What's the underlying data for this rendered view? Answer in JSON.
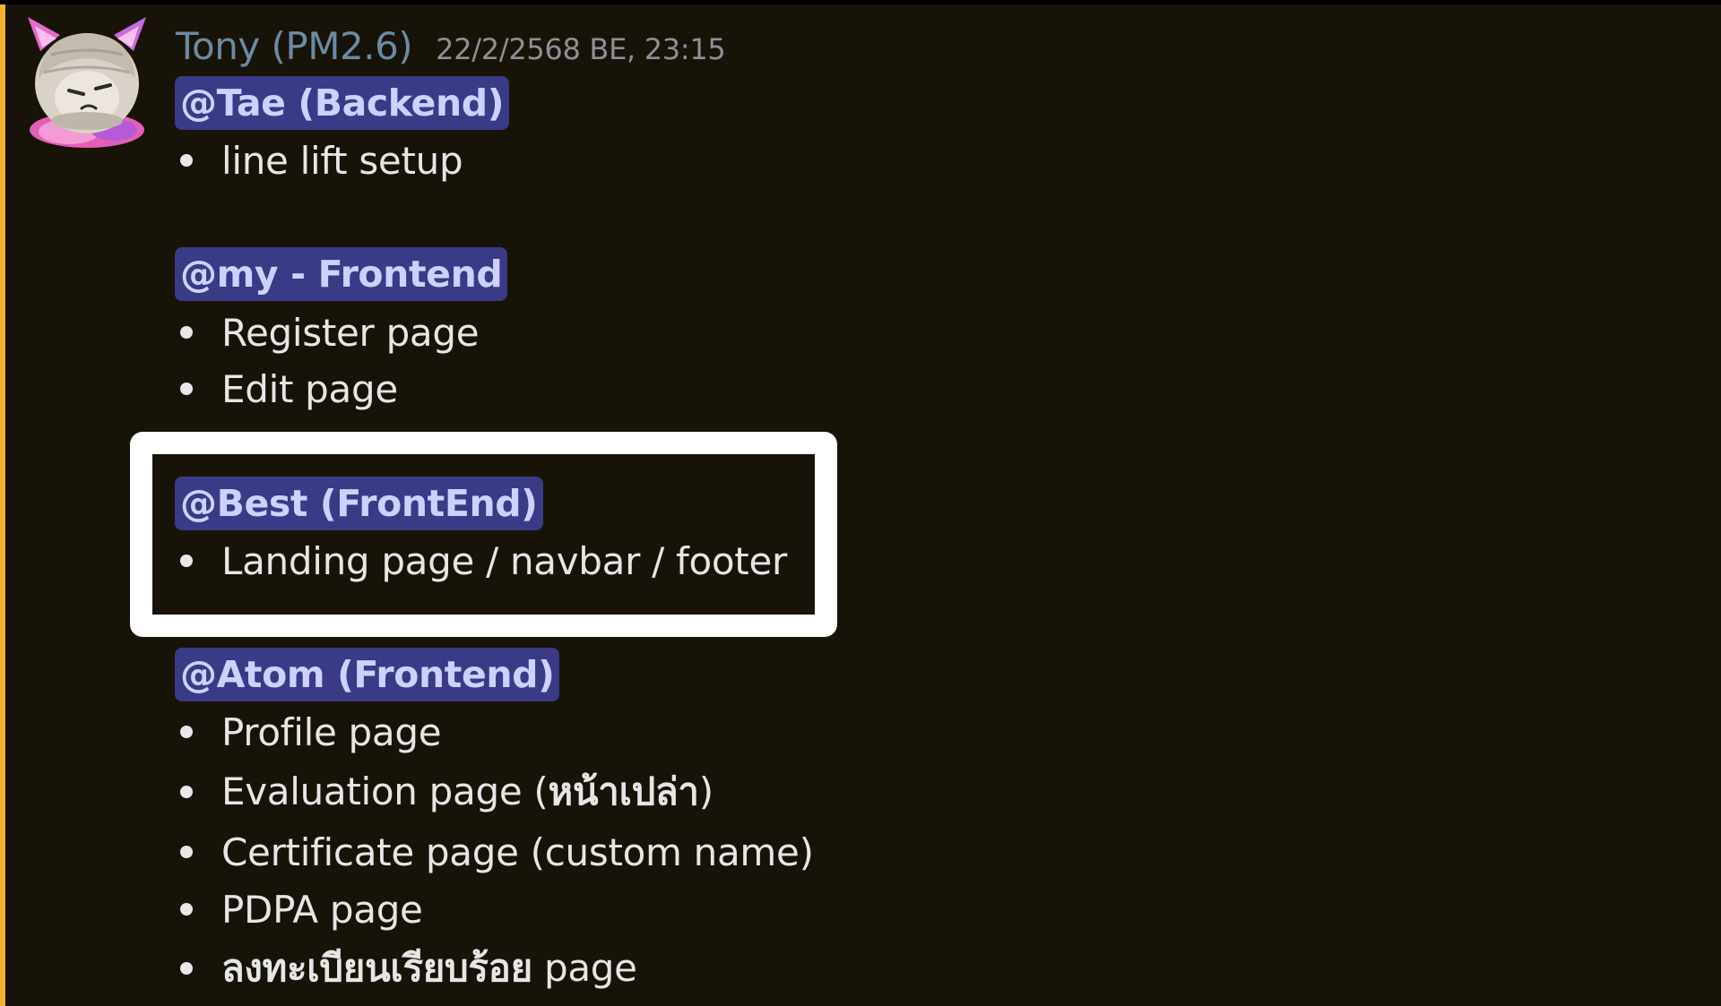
{
  "message": {
    "author": "Tony (PM2.6)",
    "timestamp": "22/2/2568 BE, 23:15",
    "avatar_icon": "anime-avatar-icon"
  },
  "sections": [
    {
      "mention": "@Tae (Backend)",
      "items": [
        "line lift setup"
      ]
    },
    {
      "mention": "@my - Frontend",
      "items": [
        "Register page",
        "Edit page"
      ]
    },
    {
      "mention": "@Best (FrontEnd)",
      "items": [
        "Landing page / navbar / footer"
      ]
    },
    {
      "mention": "@Atom (Frontend)",
      "items": [
        {
          "pre": "Evaluation page (",
          "bold": "หน้าเปล่า",
          "post": ")"
        },
        "Profile page",
        "Certificate page (custom name)",
        "PDPA page",
        {
          "pre": "",
          "bold": "ลงทะเบียนเรียบร้อย",
          "post": " page"
        }
      ]
    }
  ],
  "colors": {
    "background": "#181308",
    "accent_bar": "#f0b232",
    "mention_bg": "#3b3a86",
    "mention_text": "#ccd1ff",
    "author": "#6c8aa3",
    "highlight_border": "#ffffff"
  }
}
